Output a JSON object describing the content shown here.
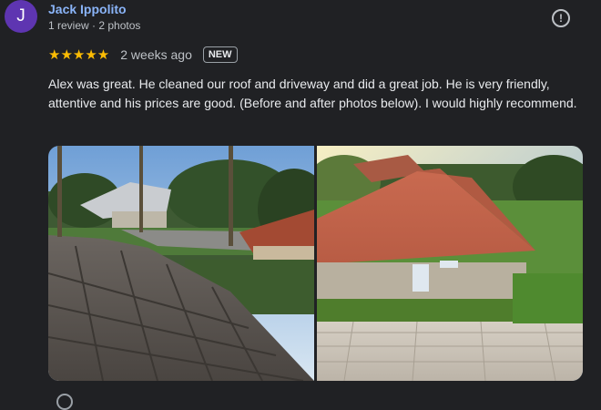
{
  "reviewer": {
    "initial": "J",
    "name": "Jack Ippolito",
    "meta": "1 review · 2 photos"
  },
  "review": {
    "stars": "★★★★★",
    "rating": 5,
    "date": "2 weeks ago",
    "badge": "NEW",
    "text": "Alex was great. He cleaned our roof and driveway and did a great job. He is very friendly, attentive and his prices are good. (Before and after photos below). I would highly recommend."
  },
  "icons": {
    "report": "report-icon"
  },
  "colors": {
    "name": "#8ab4f8",
    "stars": "#fbbc04",
    "avatar": "#5e35b1",
    "background": "#202124"
  }
}
